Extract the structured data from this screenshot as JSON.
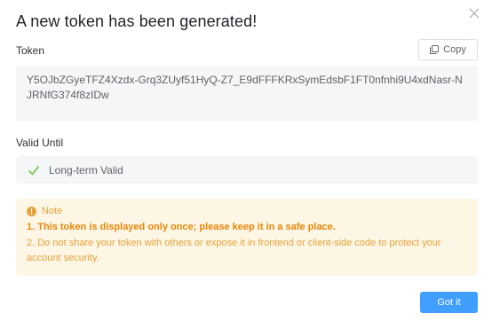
{
  "dialog": {
    "title": "A new token has been generated!",
    "close_icon": "close-icon"
  },
  "token": {
    "label": "Token",
    "copy_label": "Copy",
    "copy_icon": "copy-icon",
    "value": "Y5OJbZGyeTFZ4Xzdx-Grq3ZUyf51HyQ-Z7_E9dFFFKRxSymEdsbF1FT0nfnhi9U4xdNasr-NJRNfG374f8zIDw"
  },
  "validity": {
    "label": "Valid Until",
    "value": "Long-term Valid",
    "icon": "check-icon"
  },
  "note": {
    "title": "Note",
    "icon": "info-icon",
    "line1": "1. This token is displayed only once; please keep it in a safe place.",
    "line2": "2. Do not share your token with others or expose it in frontend or client-side code to protect your account security."
  },
  "footer": {
    "confirm_label": "Got it"
  },
  "colors": {
    "primary": "#409eff",
    "success": "#67c23a",
    "warning": "#e6a23c",
    "warning_bg": "#fdf6e4",
    "panel_bg": "#f5f6f8"
  }
}
